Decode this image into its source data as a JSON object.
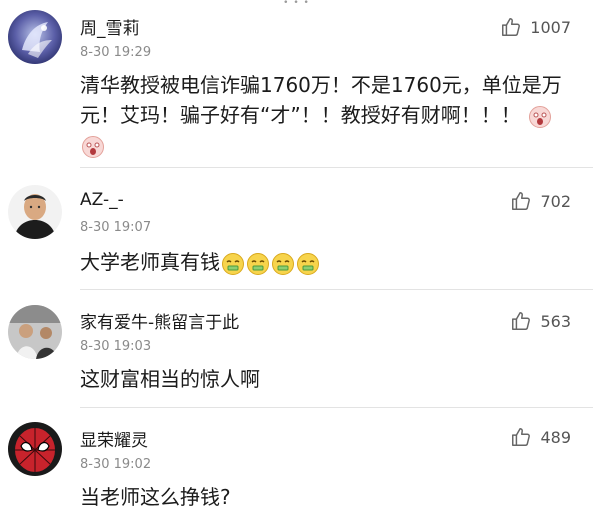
{
  "comments": [
    {
      "name": "周_雪莉",
      "time": "8-30 19:29",
      "likes": "1007",
      "text": "清华教授被电信诈骗1760万！不是1760元，单位是万元！艾玛！骗子好有“才”！！教授好有财啊！！！",
      "emoji": "shocked-face-icon",
      "emoji_count": 2
    },
    {
      "name": "AZ-_-",
      "time": "8-30 19:07",
      "likes": "702",
      "text": "大学老师真有钱",
      "emoji": "money-mouth-face-icon",
      "emoji_count": 4
    },
    {
      "name": "家有爱牛-熊留言于此",
      "time": "8-30 19:03",
      "likes": "563",
      "text": "这财富相当的惊人啊"
    },
    {
      "name": "显荣耀灵",
      "time": "8-30 19:02",
      "likes": "489",
      "text": "当老师这么挣钱?"
    }
  ],
  "icons": {
    "like": "thumbs-up-icon"
  },
  "colors": {
    "text": "#1b1b1b",
    "meta": "#8a8a8a",
    "divider": "#e3e3e3"
  }
}
